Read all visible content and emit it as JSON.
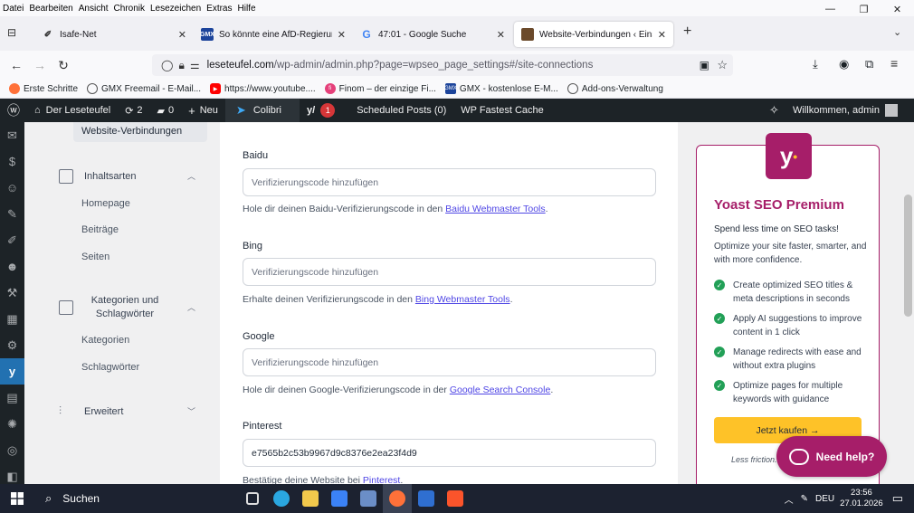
{
  "browser": {
    "menu": [
      "Datei",
      "Bearbeiten",
      "Ansicht",
      "Chronik",
      "Lesezeichen",
      "Extras",
      "Hilfe"
    ],
    "tabs": [
      {
        "title": "Isafe-Net",
        "favicon": "isafe-icon"
      },
      {
        "title": "So könnte eine AfD-Regierung",
        "favicon": "gmx-icon"
      },
      {
        "title": "47:01 - Google Suche",
        "favicon": "google-icon"
      },
      {
        "title": "Website-Verbindungen ‹ Einstel",
        "favicon": "leseteufel-icon",
        "active": true
      }
    ],
    "url_host": "leseteufel.com",
    "url_path": "/wp-admin/admin.php?page=wpseo_page_settings#/site-connections",
    "bookmarks": [
      {
        "label": "Erste Schritte",
        "color": "#ff7139"
      },
      {
        "label": "GMX Freemail - E-Mail...",
        "color": "#555555"
      },
      {
        "label": "https://www.youtube....",
        "color": "#ff0000"
      },
      {
        "label": "Finom – der einzige Fi...",
        "color": "#e5407a"
      },
      {
        "label": "GMX - kostenlose E-M...",
        "color": "#1c449b"
      },
      {
        "label": "Add-ons-Verwaltung",
        "color": "#555555"
      }
    ]
  },
  "adminbar": {
    "site": "Der Leseteufel",
    "updates": "2",
    "comments": "0",
    "new": "Neu",
    "colibri": "Colibri",
    "yoast_badge": "1",
    "scheduled": "Scheduled Posts (0)",
    "cache": "WP Fastest Cache",
    "greeting": "Willkommen, admin"
  },
  "nav": {
    "active_item": "Website-Verbindungen",
    "groups": [
      {
        "label": "Inhaltsarten",
        "items": [
          "Homepage",
          "Beiträge",
          "Seiten"
        ]
      },
      {
        "label": "Kategorien und Schlagwörter",
        "label_line1": "Kategorien und",
        "label_line2": "Schlagwörter",
        "items": [
          "Kategorien",
          "Schlagwörter"
        ]
      },
      {
        "label": "Erweitert",
        "items": []
      }
    ]
  },
  "fields": {
    "baidu": {
      "label": "Baidu",
      "placeholder": "Verifizierungscode hinzufügen",
      "help": "Hole dir deinen Baidu-Verifizierungscode in den ",
      "link": "Baidu Webmaster Tools",
      "suffix": "."
    },
    "bing": {
      "label": "Bing",
      "placeholder": "Verifizierungscode hinzufügen",
      "help": "Erhalte deinen Verifizierungscode in den ",
      "link": "Bing Webmaster Tools",
      "suffix": "."
    },
    "google": {
      "label": "Google",
      "placeholder": "Verifizierungscode hinzufügen",
      "help": "Hole dir deinen Google-Verifizierungscode in der ",
      "link": "Google Search Console",
      "suffix": "."
    },
    "pinterest": {
      "label": "Pinterest",
      "value": "e7565b2c53b9967d9c8376e2ea23f4d9",
      "help": "Bestätige deine Website bei ",
      "link": "Pinterest",
      "suffix": "."
    }
  },
  "upsell": {
    "title": "Yoast SEO Premium",
    "tagline": "Spend less time on SEO tasks!",
    "description": "Optimize your site faster, smarter, and with more confidence.",
    "features": [
      "Create optimized SEO titles & meta descriptions in seconds",
      "Apply AI suggestions to improve content in 1 click",
      "Manage redirects with ease and without extra plugins",
      "Optimize pages for multiple keywords with guidance"
    ],
    "button": "Jetzt kaufen →",
    "footer": "Less friction."
  },
  "help_bubble": "Need help?",
  "taskbar": {
    "search": "Suchen",
    "lang": "DEU",
    "time": "23:56",
    "date": "27.01.2026"
  },
  "colors": {
    "yoast": "#a61e69",
    "wp_dark": "#1d2327",
    "wp_blue": "#2271b1",
    "buy": "#fec228",
    "check": "#22a057"
  }
}
